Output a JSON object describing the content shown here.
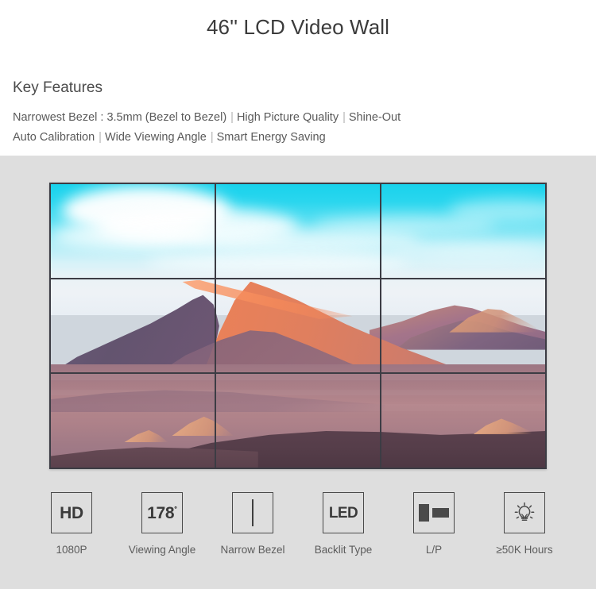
{
  "header": {
    "product_title": "46'' LCD Video Wall",
    "key_features_heading": "Key Features",
    "feature_line_1": [
      "Narrowest Bezel : 3.5mm (Bezel to Bezel)",
      "High Picture Quality",
      "Shine-Out"
    ],
    "feature_line_2": [
      "Auto Calibration",
      "Wide Viewing Angle",
      "Smart Energy Saving"
    ],
    "separator": "|"
  },
  "showcase": {
    "background_color": "#dedede",
    "video_wall": {
      "name": "video-wall-3x3",
      "rows": 3,
      "columns": 3,
      "bezel_color": "#3c3c44",
      "scene_description": "desert sand dunes under cyan sky"
    }
  },
  "specs": [
    {
      "icon": "hd-icon",
      "icon_text": "HD",
      "caption": "1080P"
    },
    {
      "icon": "viewing-angle-icon",
      "icon_text": "178",
      "icon_suffix": "°",
      "caption": "Viewing Angle"
    },
    {
      "icon": "narrow-bezel-icon",
      "icon_text": "",
      "caption": "Narrow Bezel"
    },
    {
      "icon": "led-icon",
      "icon_text": "LED",
      "caption": "Backlit Type"
    },
    {
      "icon": "landscape-portrait-icon",
      "icon_text": "",
      "caption": "L/P"
    },
    {
      "icon": "lightbulb-icon",
      "icon_text": "",
      "caption": "≥50K Hours"
    }
  ]
}
